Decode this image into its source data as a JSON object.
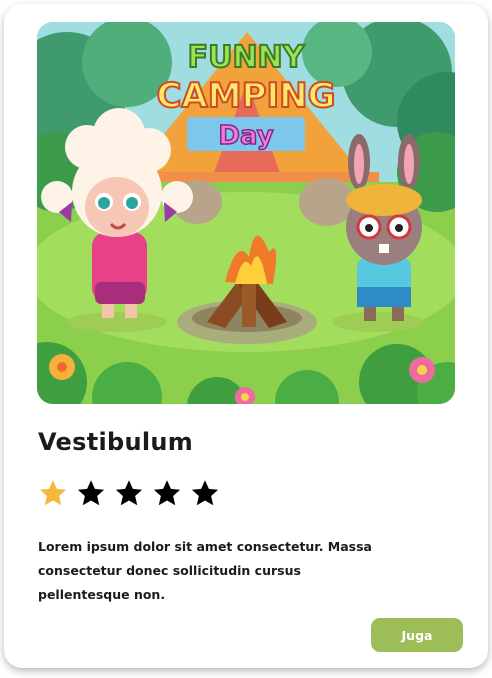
{
  "card": {
    "image": {
      "logo_line1": "FUNNY",
      "logo_line2": "CAMPING",
      "logo_line3": "Day"
    },
    "title": "Vestibulum",
    "rating": {
      "value": 1,
      "max": 5,
      "filled_color": "#f6b73c",
      "empty_color": "#000000"
    },
    "description": "Lorem ipsum dolor sit amet consectetur. Massa consectetur donec sollicitudin cursus pellentesque non.",
    "play_label": "Juga",
    "button_color": "#9cbd57"
  }
}
